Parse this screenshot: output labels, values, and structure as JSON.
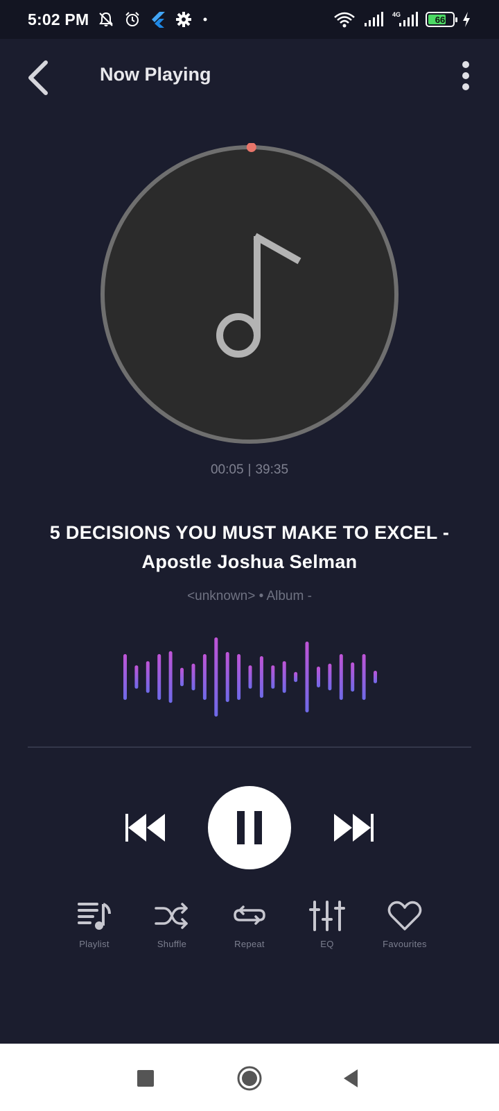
{
  "status_bar": {
    "time": "5:02 PM",
    "battery_level": "66",
    "icons": [
      "mute-icon",
      "alarm-icon",
      "flutter-icon",
      "gear-icon",
      "dot-icon",
      "wifi-icon",
      "signal-icon",
      "4g-signal-icon",
      "battery-icon",
      "charging-icon"
    ]
  },
  "header": {
    "title": "Now Playing",
    "back_icon": "chevron-left-icon",
    "menu_icon": "more-vertical-icon"
  },
  "player": {
    "artwork_icon": "music-note-icon",
    "progress_fraction": 0.0021,
    "elapsed": "00:05",
    "separator": "|",
    "duration": "39:35",
    "title": "5 DECISIONS YOU MUST MAKE TO EXCEL - Apostle Joshua Selman",
    "meta": "<unknown> • Album -",
    "waveform_levels": [
      0.55,
      0.28,
      0.38,
      0.55,
      0.62,
      0.22,
      0.32,
      0.55,
      0.95,
      0.6,
      0.55,
      0.28,
      0.5,
      0.28,
      0.38,
      0.12,
      0.85,
      0.25,
      0.32,
      0.55,
      0.35,
      0.55,
      0.15
    ],
    "accent_colors": [
      "#c054d6",
      "#6e6ae8"
    ]
  },
  "controls": {
    "previous_icon": "skip-previous-icon",
    "pause_icon": "pause-icon",
    "next_icon": "skip-next-icon"
  },
  "actions": [
    {
      "label": "Playlist",
      "icon": "playlist-icon"
    },
    {
      "label": "Shuffle",
      "icon": "shuffle-icon"
    },
    {
      "label": "Repeat",
      "icon": "repeat-icon"
    },
    {
      "label": "EQ",
      "icon": "equalizer-icon"
    },
    {
      "label": "Favourites",
      "icon": "heart-icon"
    }
  ],
  "nav_bar": {
    "icons": [
      "recents-square-icon",
      "home-circle-icon",
      "back-triangle-icon"
    ]
  },
  "colors": {
    "background": "#1b1d2e",
    "progress_ring": "#6f6f6f",
    "progress_thumb": "#e8756a",
    "artwork_fill": "#2b2b2b"
  }
}
